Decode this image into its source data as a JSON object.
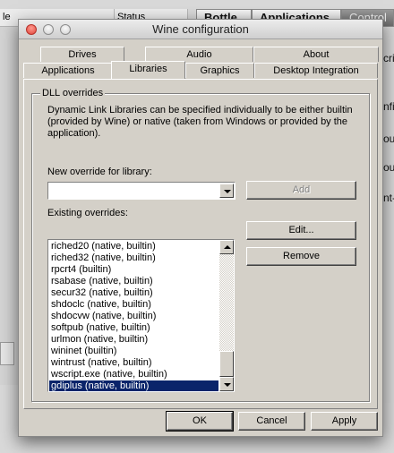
{
  "background": {
    "columns": [
      "le",
      "Status"
    ],
    "sub_text": "nfo",
    "tabs": [
      {
        "label": "Bottle",
        "active": false
      },
      {
        "label": "Applications",
        "active": false
      },
      {
        "label": "Control",
        "active": true
      }
    ],
    "right_fragments": [
      "cri",
      "nfi",
      "oul",
      "ou",
      "nt-"
    ]
  },
  "window": {
    "title": "Wine configuration",
    "tabs_top": [
      "Drives",
      "Audio",
      "About"
    ],
    "tabs_bottom": [
      "Applications",
      "Libraries",
      "Graphics",
      "Desktop Integration"
    ],
    "active_tab": "Libraries"
  },
  "dll_overrides": {
    "group_title": "DLL overrides",
    "description": "Dynamic Link Libraries can be specified individually to be either builtin (provided by Wine) or native (taken from Windows or provided by the application).",
    "new_override_label": "New override for library:",
    "new_override_value": "",
    "add_button": "Add",
    "existing_label": "Existing overrides:",
    "edit_button": "Edit...",
    "remove_button": "Remove",
    "overrides": [
      "riched20 (native, builtin)",
      "riched32 (native, builtin)",
      "rpcrt4 (builtin)",
      "rsabase (native, builtin)",
      "secur32 (native, builtin)",
      "shdoclc (native, builtin)",
      "shdocvw (native, builtin)",
      "softpub (native, builtin)",
      "urlmon (native, builtin)",
      "wininet (builtin)",
      "wintrust (native, builtin)",
      "wscript.exe (native, builtin)",
      "gdiplus (native, builtin)"
    ],
    "selected_override": "gdiplus (native, builtin)"
  },
  "footer": {
    "ok": "OK",
    "cancel": "Cancel",
    "apply": "Apply"
  },
  "colors": {
    "selection": "#0a246a",
    "dialog_face": "#d4d0c8"
  }
}
